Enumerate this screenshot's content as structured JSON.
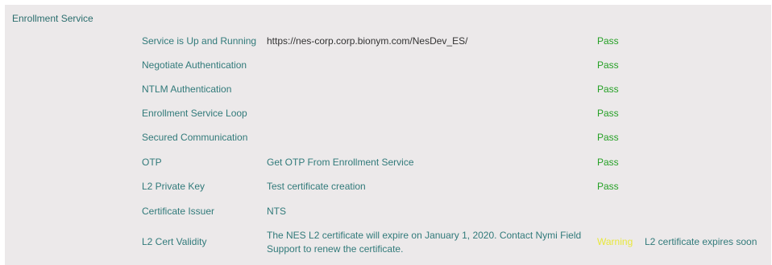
{
  "section": {
    "title": "Enrollment Service"
  },
  "checks": [
    {
      "name": "Service is Up and Running",
      "detail": "https://nes-corp.corp.bionym.com/NesDev_ES/",
      "status": "Pass",
      "note": ""
    },
    {
      "name": "Negotiate Authentication",
      "detail": "",
      "status": "Pass",
      "note": ""
    },
    {
      "name": "NTLM Authentication",
      "detail": "",
      "status": "Pass",
      "note": ""
    },
    {
      "name": "Enrollment Service Loop",
      "detail": "",
      "status": "Pass",
      "note": ""
    },
    {
      "name": "Secured Communication",
      "detail": "",
      "status": "Pass",
      "note": ""
    },
    {
      "name": "OTP",
      "detail": "Get OTP From Enrollment Service",
      "status": "Pass",
      "note": ""
    },
    {
      "name": "L2 Private Key",
      "detail": "Test certificate creation",
      "status": "Pass",
      "note": ""
    },
    {
      "name": "Certificate Issuer",
      "detail": "NTS",
      "status": "",
      "note": ""
    },
    {
      "name": "L2 Cert Validity",
      "detail": "The NES L2 certificate will expire on January 1, 2020. Contact Nymi Field Support to renew the certificate.",
      "status": "Warning",
      "note": "L2 certificate expires soon"
    }
  ],
  "colors": {
    "panel_background": "#ece9ea",
    "label_teal": "#317a7a",
    "pass_green": "#25a025",
    "warning_yellow": "#e8e83c"
  }
}
